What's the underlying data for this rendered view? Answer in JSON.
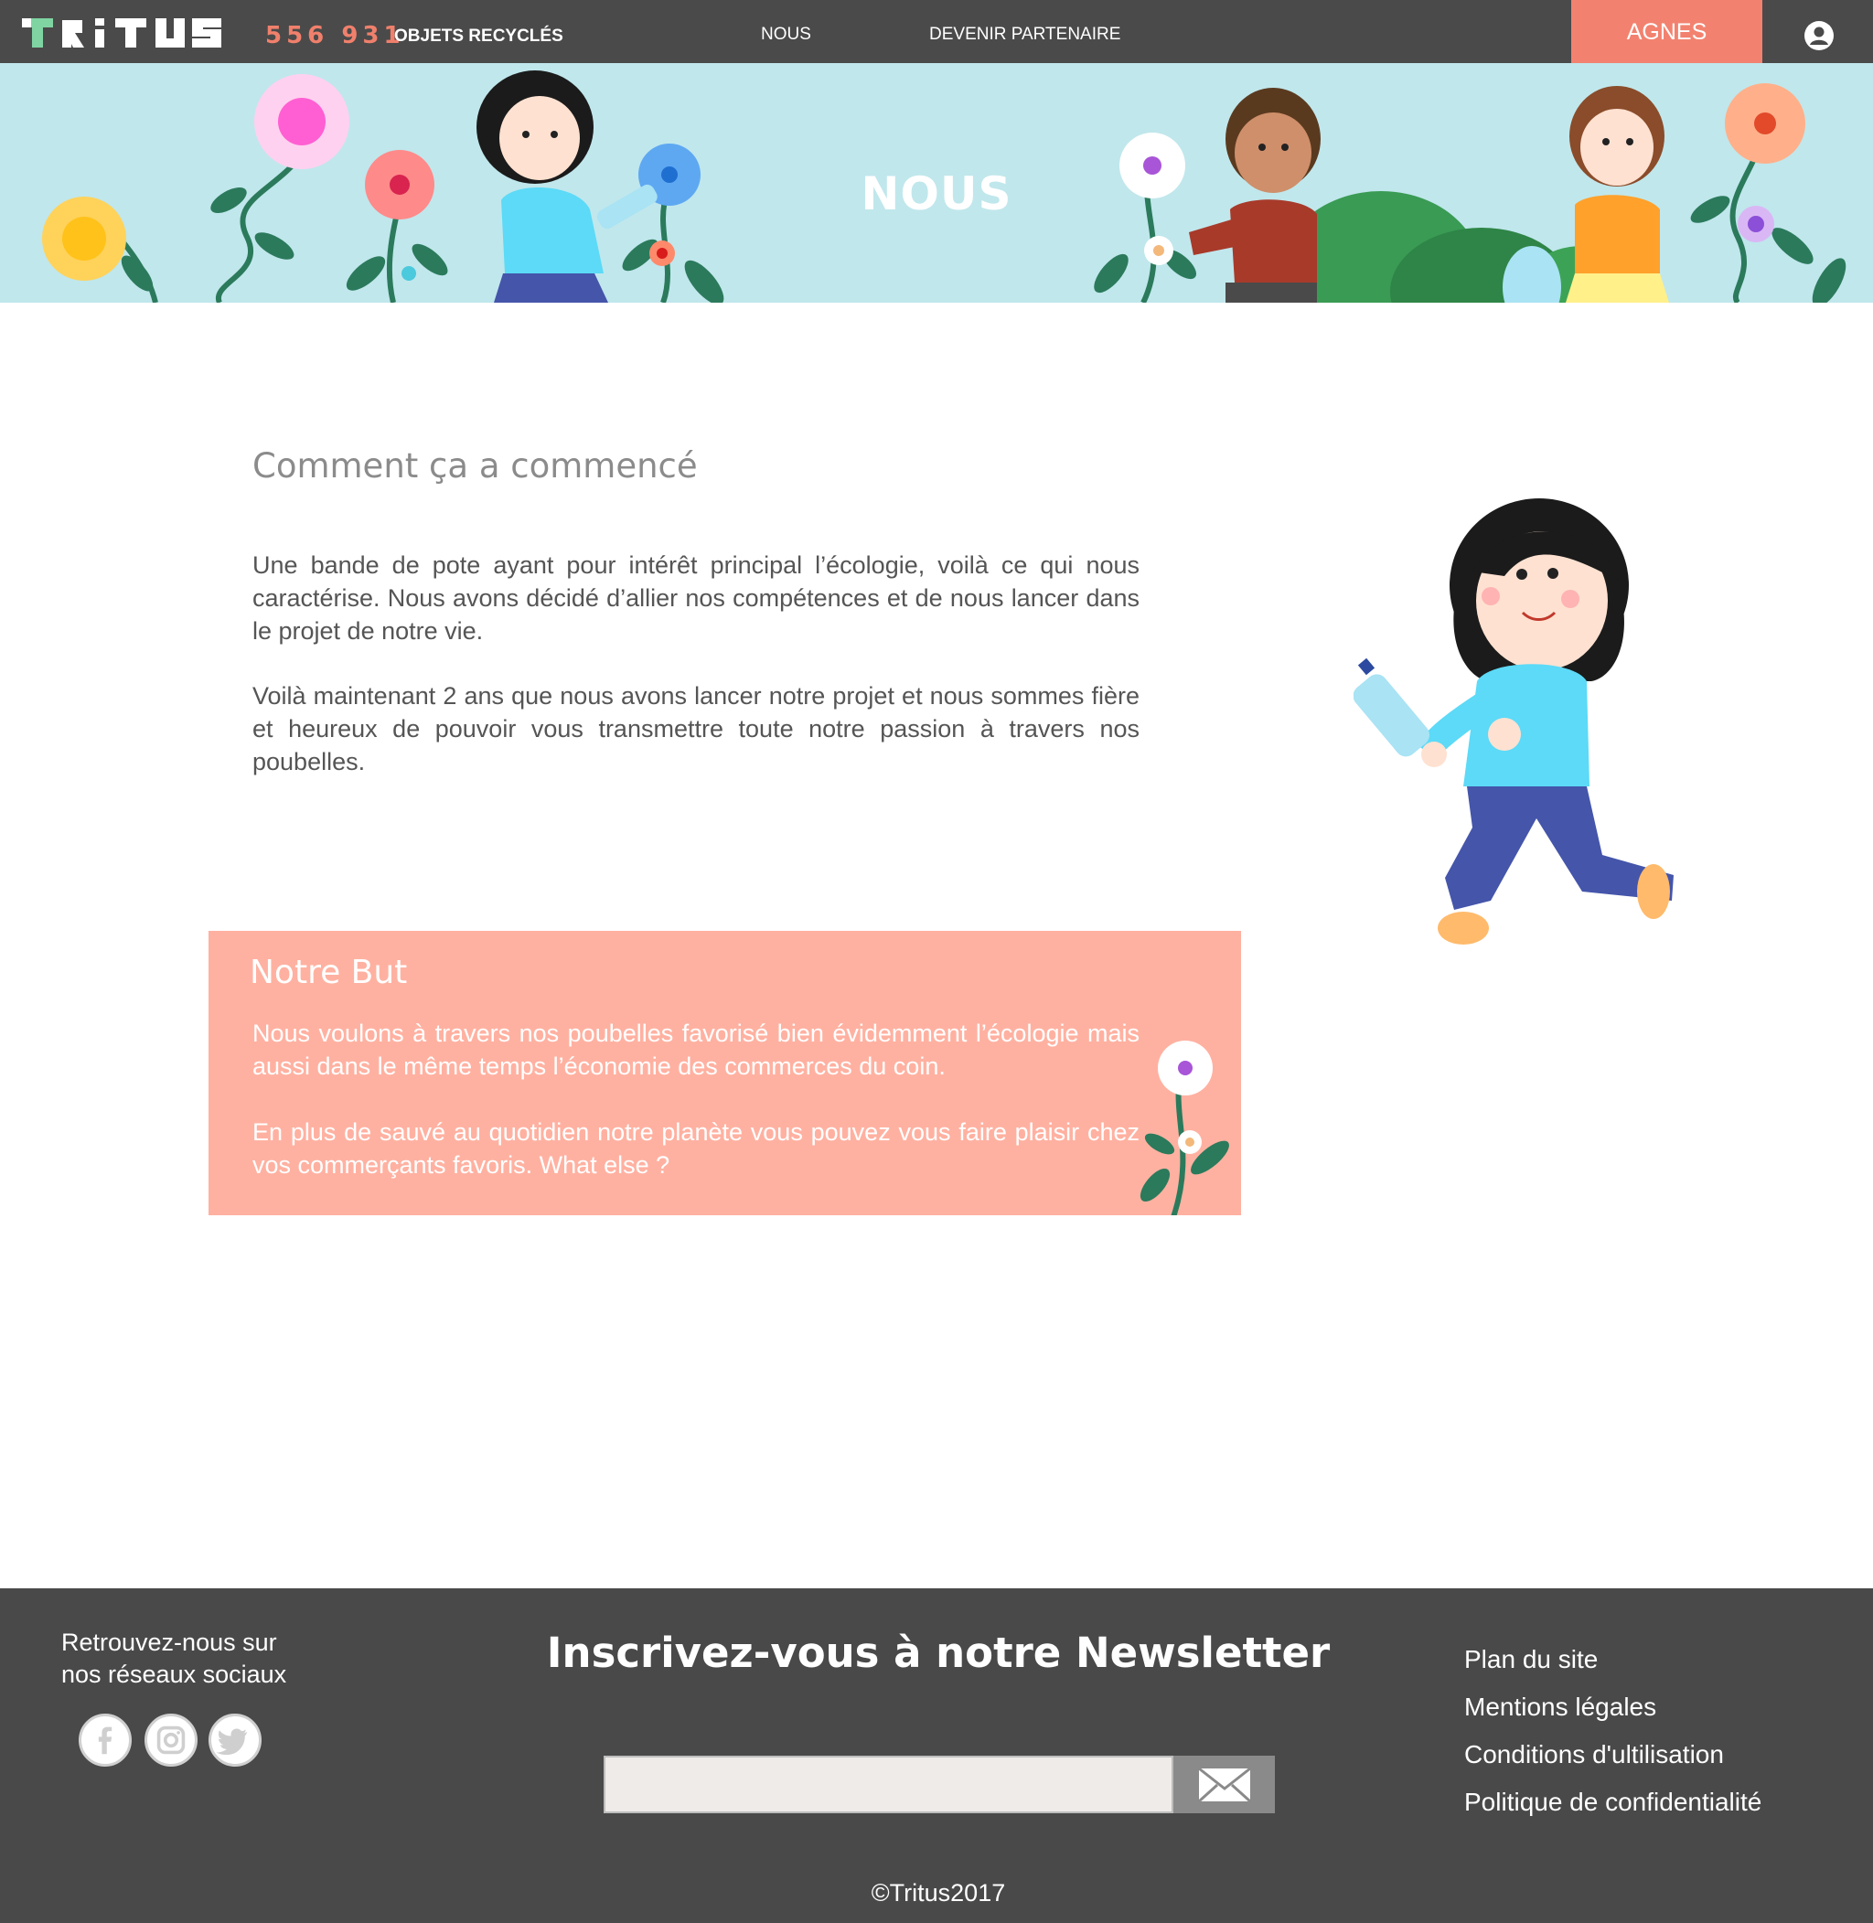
{
  "header": {
    "logo_text": "TRiTUS",
    "counter_value": "556 931",
    "counter_label": "OBJETS RECYCLÉS",
    "nav": [
      {
        "label": "NOUS"
      },
      {
        "label": "DEVENIR PARTENAIRE"
      }
    ],
    "user_name": "AGNES"
  },
  "banner": {
    "title": "NOUS"
  },
  "intro": {
    "title": "Comment ça a commencé",
    "paragraph1": "Une bande de pote ayant pour intérêt principal l’écologie, voilà ce qui nous caractérise. Nous avons décidé d’allier nos compétences et de nous lancer dans le projet de notre vie.",
    "paragraph2": " Voilà maintenant 2 ans que nous avons lancer notre projet et nous sommes fière et heureux de pouvoir vous transmettre toute notre passion à travers nos poubelles."
  },
  "goal": {
    "title": "Notre But",
    "paragraph1": "Nous voulons à travers nos poubelles favorisé bien évidemment l’écologie mais aussi dans le même temps l’économie des commerces du coin.",
    "paragraph2": "En plus de sauvé au quotidien notre planète vous pouvez vous faire plaisir chez vos commerçants favoris. What else ?"
  },
  "footer": {
    "social_line1": "Retrouvez-nous sur",
    "social_line2": "nos réseaux sociaux",
    "social_icons": [
      "facebook-icon",
      "instagram-icon",
      "twitter-icon"
    ],
    "newsletter_title": "Inscrivez-vous à notre Newsletter",
    "email_placeholder": "",
    "links": [
      {
        "label": "Plan du site"
      },
      {
        "label": "Mentions légales"
      },
      {
        "label": "Conditions d'ultilisation"
      },
      {
        "label": "Politique de confidentialité"
      }
    ],
    "copyright": "©Tritus2017"
  },
  "colors": {
    "header_bg": "#4a4a4a",
    "accent": "#f2826f",
    "banner_bg": "#c0e7ec",
    "goal_bg": "#ffb1a1",
    "footer_bg": "#494949"
  }
}
